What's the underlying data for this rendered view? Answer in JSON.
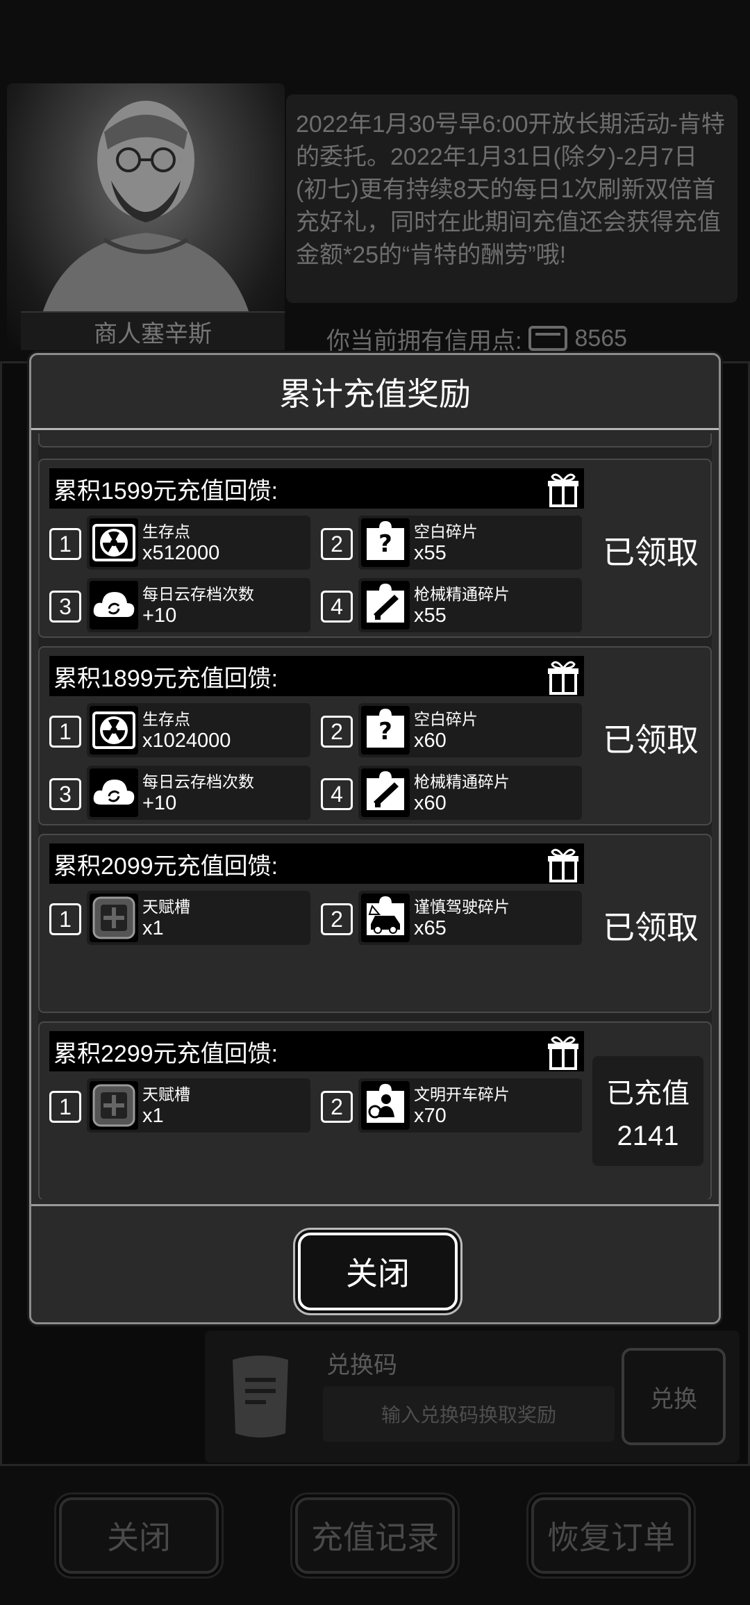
{
  "merchant": {
    "name": "商人塞辛斯"
  },
  "announcement": {
    "text": "2022年1月30号早6:00开放长期活动-肯特的委托。2022年1月31日(除夕)-2月7日(初七)更有持续8天的每日1次刷新双倍首充好礼，同时在此期间充值还会获得充值金额*25的“肯特的酬劳”哦!"
  },
  "credits": {
    "label": "你当前拥有信用点:",
    "value": "8565"
  },
  "redeem": {
    "title": "兑换码",
    "placeholder": "输入兑换码换取奖励",
    "button_label": "兑换"
  },
  "bottom_buttons": {
    "close": "关闭",
    "recharge_record": "充值记录",
    "restore_order": "恢复订单"
  },
  "modal": {
    "title": "累计充值奖励",
    "close_label": "关闭",
    "tiers": [
      {
        "title": "累积1599元充值回馈:",
        "status": "已领取",
        "rewards": [
          {
            "index": "1",
            "name": "生存点",
            "qty": "x512000",
            "icon": "radiation-icon"
          },
          {
            "index": "2",
            "name": "空白碎片",
            "qty": "x55",
            "icon": "puzzle-question-icon"
          },
          {
            "index": "3",
            "name": "每日云存档次数",
            "qty": "+10",
            "icon": "cloud-sync-icon"
          },
          {
            "index": "4",
            "name": "枪械精通碎片",
            "qty": "x55",
            "icon": "puzzle-gun-icon"
          }
        ]
      },
      {
        "title": "累积1899元充值回馈:",
        "status": "已领取",
        "rewards": [
          {
            "index": "1",
            "name": "生存点",
            "qty": "x1024000",
            "icon": "radiation-icon"
          },
          {
            "index": "2",
            "name": "空白碎片",
            "qty": "x60",
            "icon": "puzzle-question-icon"
          },
          {
            "index": "3",
            "name": "每日云存档次数",
            "qty": "+10",
            "icon": "cloud-sync-icon"
          },
          {
            "index": "4",
            "name": "枪械精通碎片",
            "qty": "x60",
            "icon": "puzzle-gun-icon"
          }
        ]
      },
      {
        "title": "累积2099元充值回馈:",
        "status": "已领取",
        "rewards": [
          {
            "index": "1",
            "name": "天赋槽",
            "qty": "x1",
            "icon": "talent-slot-icon"
          },
          {
            "index": "2",
            "name": "谨慎驾驶碎片",
            "qty": "x65",
            "icon": "puzzle-car-icon"
          }
        ]
      },
      {
        "title": "累积2299元充值回馈:",
        "status_label": "已充值",
        "status_value": "2141",
        "rewards": [
          {
            "index": "1",
            "name": "天赋槽",
            "qty": "x1",
            "icon": "talent-slot-icon"
          },
          {
            "index": "2",
            "name": "文明开车碎片",
            "qty": "x70",
            "icon": "puzzle-driver-icon"
          }
        ]
      }
    ]
  }
}
